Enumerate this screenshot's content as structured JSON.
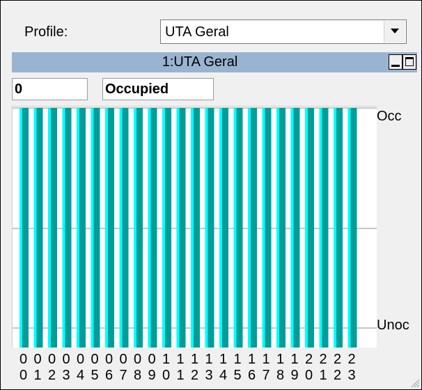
{
  "profile": {
    "label": "Profile:",
    "selected": "UTA Geral"
  },
  "panel": {
    "title": "1:UTA Geral"
  },
  "readout": {
    "count": "0",
    "state": "Occupied"
  },
  "chart_data": {
    "type": "bar",
    "categories": [
      "00",
      "01",
      "02",
      "03",
      "04",
      "05",
      "06",
      "07",
      "08",
      "09",
      "10",
      "11",
      "12",
      "13",
      "14",
      "15",
      "16",
      "17",
      "18",
      "19",
      "20",
      "21",
      "22",
      "23"
    ],
    "values": [
      1,
      1,
      1,
      1,
      1,
      1,
      1,
      1,
      1,
      1,
      1,
      1,
      1,
      1,
      1,
      1,
      1,
      1,
      1,
      1,
      1,
      1,
      1,
      1
    ],
    "y_levels": [
      "Unoc",
      "Occ"
    ],
    "ylim": [
      0,
      1
    ],
    "grid": true,
    "colors": {
      "bar": "#009d9a",
      "bar_highlight": "#00ffff",
      "grid": "#8c8c8c"
    }
  }
}
